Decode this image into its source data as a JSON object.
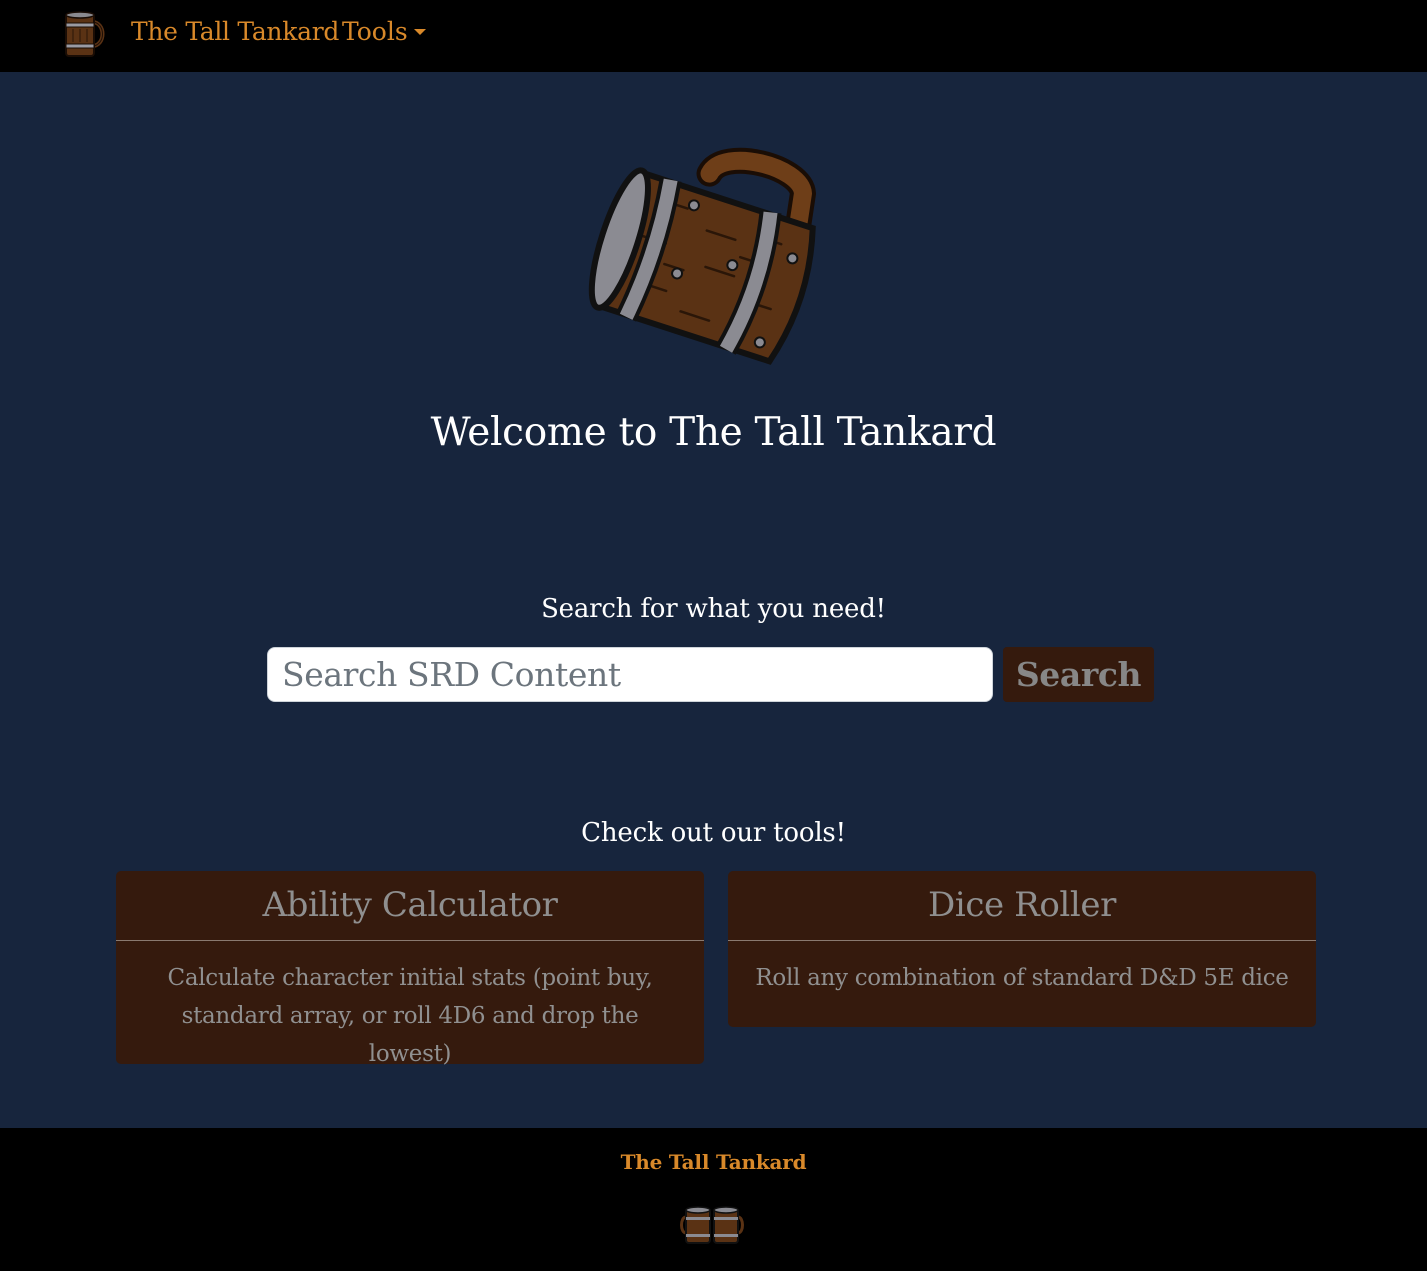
{
  "navbar": {
    "brand": "The Tall Tankard",
    "tools_label": "Tools"
  },
  "hero": {
    "welcome": "Welcome to The Tall Tankard"
  },
  "search": {
    "heading": "Search for what you need!",
    "placeholder": "Search SRD Content",
    "value": "",
    "button_label": "Search"
  },
  "tools": {
    "heading": "Check out our tools!",
    "cards": [
      {
        "title": "Ability Calculator",
        "description": "Calculate character initial stats (point buy, standard array, or roll 4D6 and drop the lowest)"
      },
      {
        "title": "Dice Roller",
        "description": "Roll any combination of standard D&D 5E dice"
      }
    ]
  },
  "footer": {
    "brand": "The Tall Tankard"
  },
  "icons": {
    "nav_logo": "tankard-icon",
    "hero_logo": "tankard-icon",
    "footer_logo": "two-tankards-icon"
  },
  "colors": {
    "page_background": "#17253d",
    "navbar_background": "#000000",
    "accent": "#d9892a",
    "card_background": "#351a0d",
    "card_text": "#8f8f8f"
  }
}
